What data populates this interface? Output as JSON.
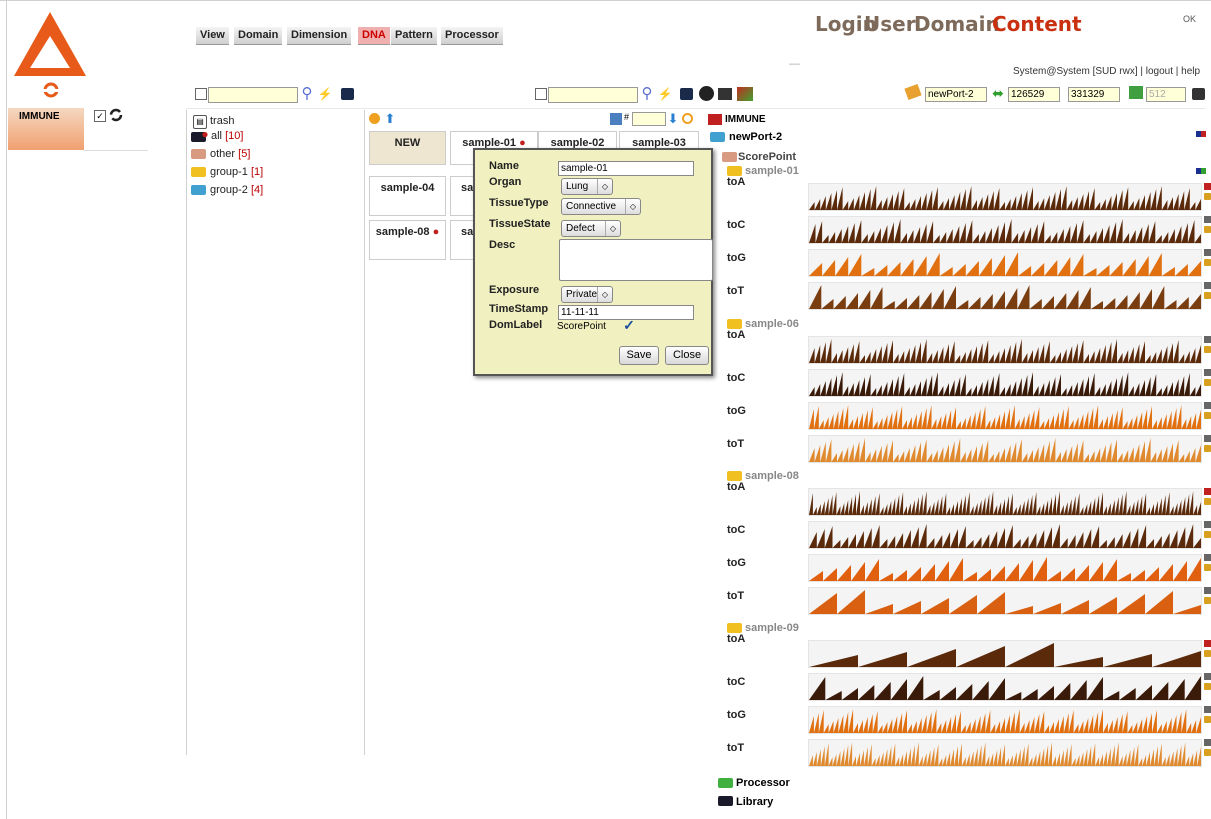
{
  "nav": {
    "tabs": [
      "View",
      "Domain",
      "Dimension",
      "DNA",
      "Pattern",
      "Processor"
    ],
    "active_tab": "DNA",
    "login": "Login",
    "user": "User",
    "domain": "Domain",
    "content": "Content",
    "corner": "OK",
    "status_line": "System@System [SUD rwx] | logout | help",
    "minimize": "—"
  },
  "left": {
    "domain_label": "IMMUNE"
  },
  "tree": {
    "items": [
      {
        "label": "trash",
        "count": ""
      },
      {
        "label": "all",
        "count": "[10]"
      },
      {
        "label": "other",
        "count": "[5]"
      },
      {
        "label": "group-1",
        "count": "[1]"
      },
      {
        "label": "group-2",
        "count": "[4]"
      }
    ]
  },
  "samples": {
    "row1": [
      "NEW",
      "sample-01",
      "sample-02",
      "sample-03"
    ],
    "row2": [
      "sample-04",
      "sa"
    ],
    "row3": [
      "sample-08",
      "sa"
    ],
    "hash": "#"
  },
  "toolbar": {
    "port": "newPort-2",
    "from": "126529",
    "to": "331329",
    "size": "512"
  },
  "dialog": {
    "name_label": "Name",
    "name_value": "sample-01",
    "organ_label": "Organ",
    "organ_value": "Lung",
    "tissuetype_label": "TissueType",
    "tissuetype_value": "Connective",
    "tissuestate_label": "TissueState",
    "tissuestate_value": "Defect",
    "desc_label": "Desc",
    "exposure_label": "Exposure",
    "exposure_value": "Private",
    "timestamp_label": "TimeStamp",
    "timestamp_value": "11-11-11",
    "domlabel_label": "DomLabel",
    "domlabel_value": "ScorePoint",
    "save": "Save",
    "close": "Close"
  },
  "tracks": {
    "root": "IMMUNE",
    "port": "newPort-2",
    "scorepoint": "ScorePoint",
    "groups": [
      {
        "name": "sample-01",
        "rows": [
          "toA",
          "toC",
          "toG",
          "toT"
        ]
      },
      {
        "name": "sample-06",
        "rows": [
          "toA",
          "toC",
          "toG",
          "toT"
        ]
      },
      {
        "name": "sample-08",
        "rows": [
          "toA",
          "toC",
          "toG",
          "toT"
        ]
      },
      {
        "name": "sample-09",
        "rows": [
          "toA",
          "toC",
          "toG",
          "toT"
        ]
      }
    ],
    "processor": "Processor",
    "library": "Library"
  },
  "colors": {
    "dark_brown": "#5a2a0a",
    "brown": "#7a3d10",
    "orange": "#e07010",
    "light_orange": "#e8a040",
    "logo": "#e85a1a"
  }
}
